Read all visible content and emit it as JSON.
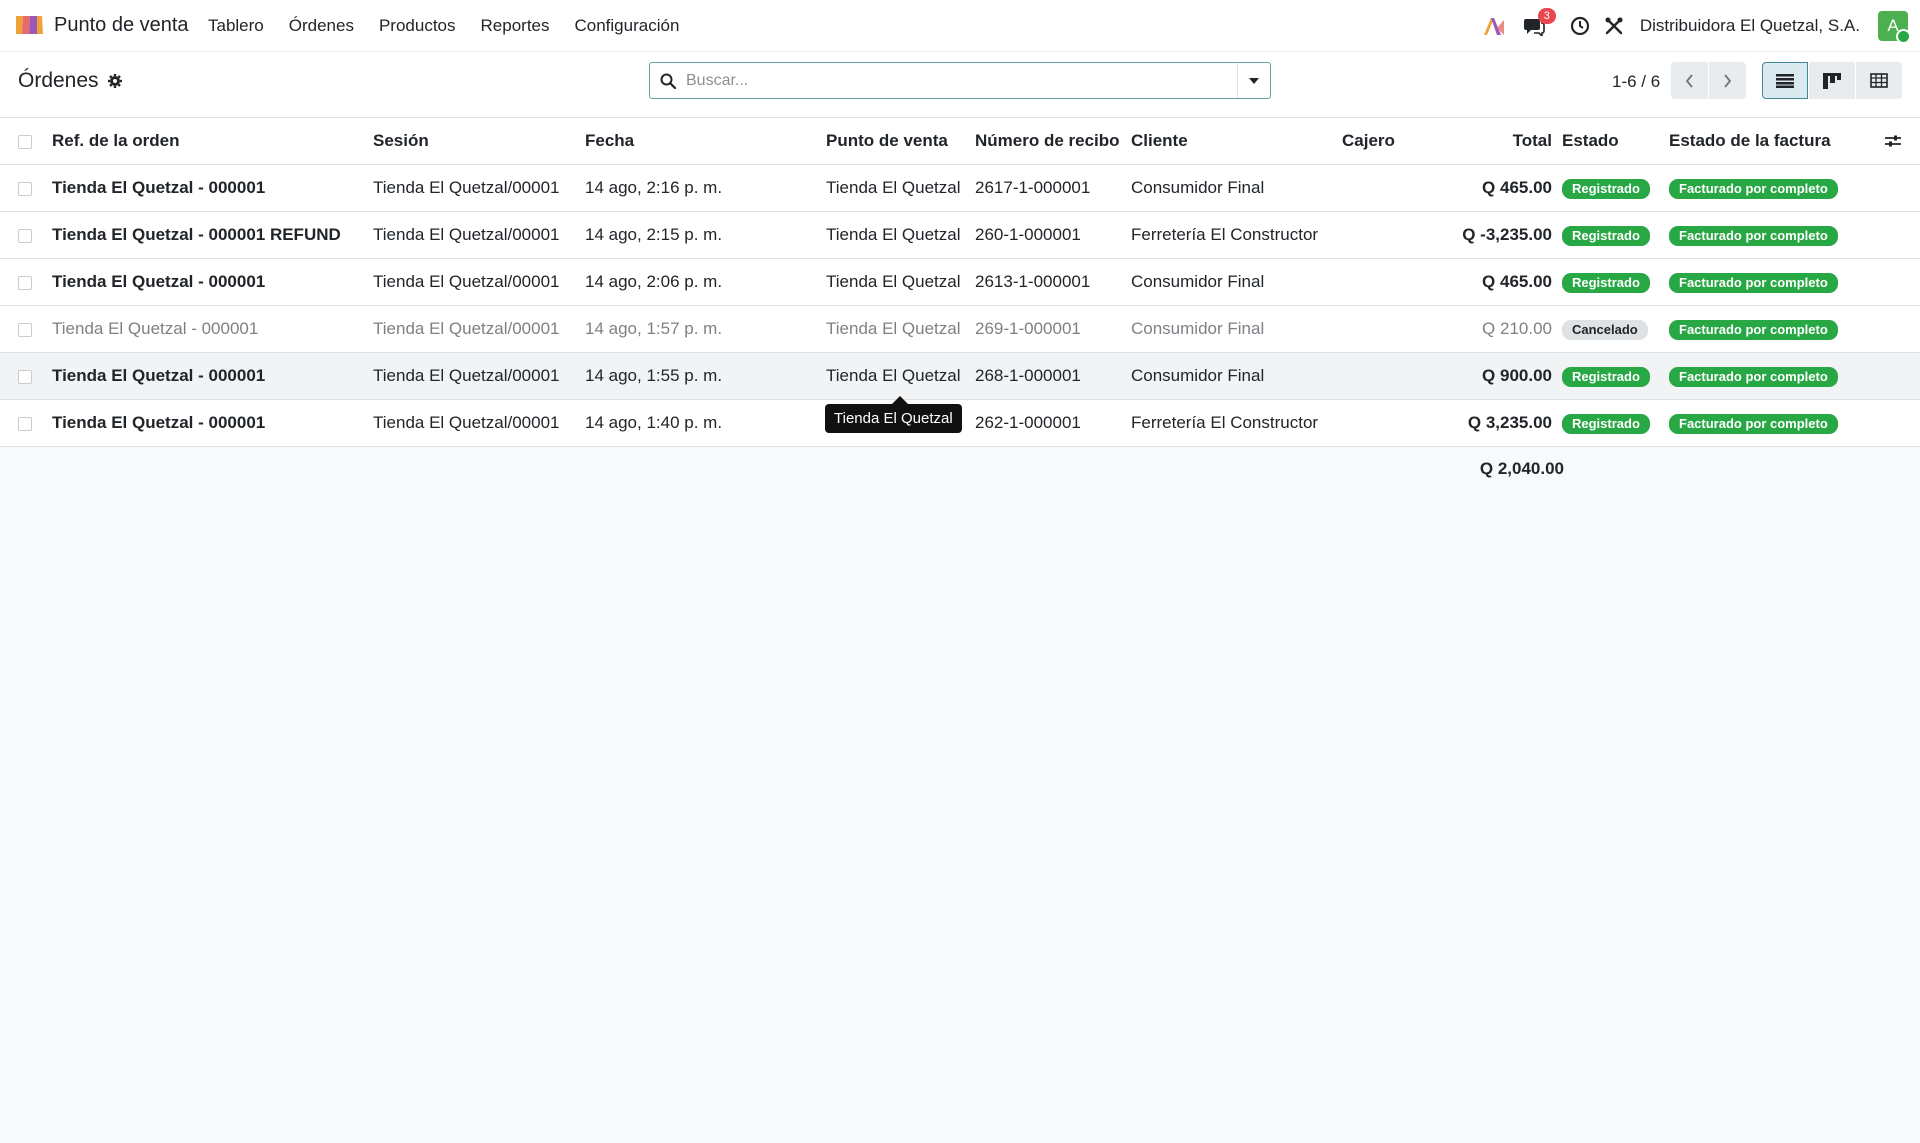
{
  "nav": {
    "app_name": "Punto de venta",
    "menu": [
      "Tablero",
      "Órdenes",
      "Productos",
      "Reportes",
      "Configuración"
    ],
    "chat_badge": "3",
    "company": "Distribuidora El Quetzal, S.A.",
    "avatar_letter": "A"
  },
  "control": {
    "title": "Órdenes",
    "search_placeholder": "Buscar...",
    "pager": "1-6 / 6"
  },
  "table": {
    "headers": {
      "ref": "Ref. de la orden",
      "session": "Sesión",
      "date": "Fecha",
      "pos": "Punto de venta",
      "receipt": "Número de recibo",
      "customer": "Cliente",
      "cashier": "Cajero",
      "total": "Total",
      "state": "Estado",
      "invoice_state": "Estado de la factura"
    },
    "rows": [
      {
        "ref": "Tienda El Quetzal - 000001",
        "session": "Tienda El Quetzal/00001",
        "date": "14 ago, 2:16 p. m.",
        "pos": "Tienda El Quetzal",
        "receipt": "2617-1-000001",
        "customer": "Consumidor Final",
        "cashier": "",
        "total": "Q 465.00",
        "state": "Registrado",
        "invoice_state": "Facturado por completo"
      },
      {
        "ref": "Tienda El Quetzal - 000001 REFUND",
        "session": "Tienda El Quetzal/00001",
        "date": "14 ago, 2:15 p. m.",
        "pos": "Tienda El Quetzal",
        "receipt": "260-1-000001",
        "customer": "Ferretería El Constructor",
        "cashier": "",
        "total": "Q -3,235.00",
        "state": "Registrado",
        "invoice_state": "Facturado por completo"
      },
      {
        "ref": "Tienda El Quetzal - 000001",
        "session": "Tienda El Quetzal/00001",
        "date": "14 ago, 2:06 p. m.",
        "pos": "Tienda El Quetzal",
        "receipt": "2613-1-000001",
        "customer": "Consumidor Final",
        "cashier": "",
        "total": "Q 465.00",
        "state": "Registrado",
        "invoice_state": "Facturado por completo"
      },
      {
        "ref": "Tienda El Quetzal - 000001",
        "session": "Tienda El Quetzal/00001",
        "date": "14 ago, 1:57 p. m.",
        "pos": "Tienda El Quetzal",
        "receipt": "269-1-000001",
        "customer": "Consumidor Final",
        "cashier": "",
        "total": "Q 210.00",
        "state": "Cancelado",
        "invoice_state": "Facturado por completo"
      },
      {
        "ref": "Tienda El Quetzal - 000001",
        "session": "Tienda El Quetzal/00001",
        "date": "14 ago, 1:55 p. m.",
        "pos": "Tienda El Quetzal",
        "receipt": "268-1-000001",
        "customer": "Consumidor Final",
        "cashier": "",
        "total": "Q 900.00",
        "state": "Registrado",
        "invoice_state": "Facturado por completo"
      },
      {
        "ref": "Tienda El Quetzal - 000001",
        "session": "Tienda El Quetzal/00001",
        "date": "14 ago, 1:40 p. m.",
        "pos": "",
        "receipt": "262-1-000001",
        "customer": "Ferretería El Constructor",
        "cashier": "",
        "total": "Q 3,235.00",
        "state": "Registrado",
        "invoice_state": "Facturado por completo"
      }
    ],
    "sum_total": "Q 2,040.00"
  },
  "tooltip": "Tienda El Quetzal",
  "colors": {
    "accent": "#3f8a96",
    "success": "#28a745",
    "badge": "#e8474c"
  }
}
